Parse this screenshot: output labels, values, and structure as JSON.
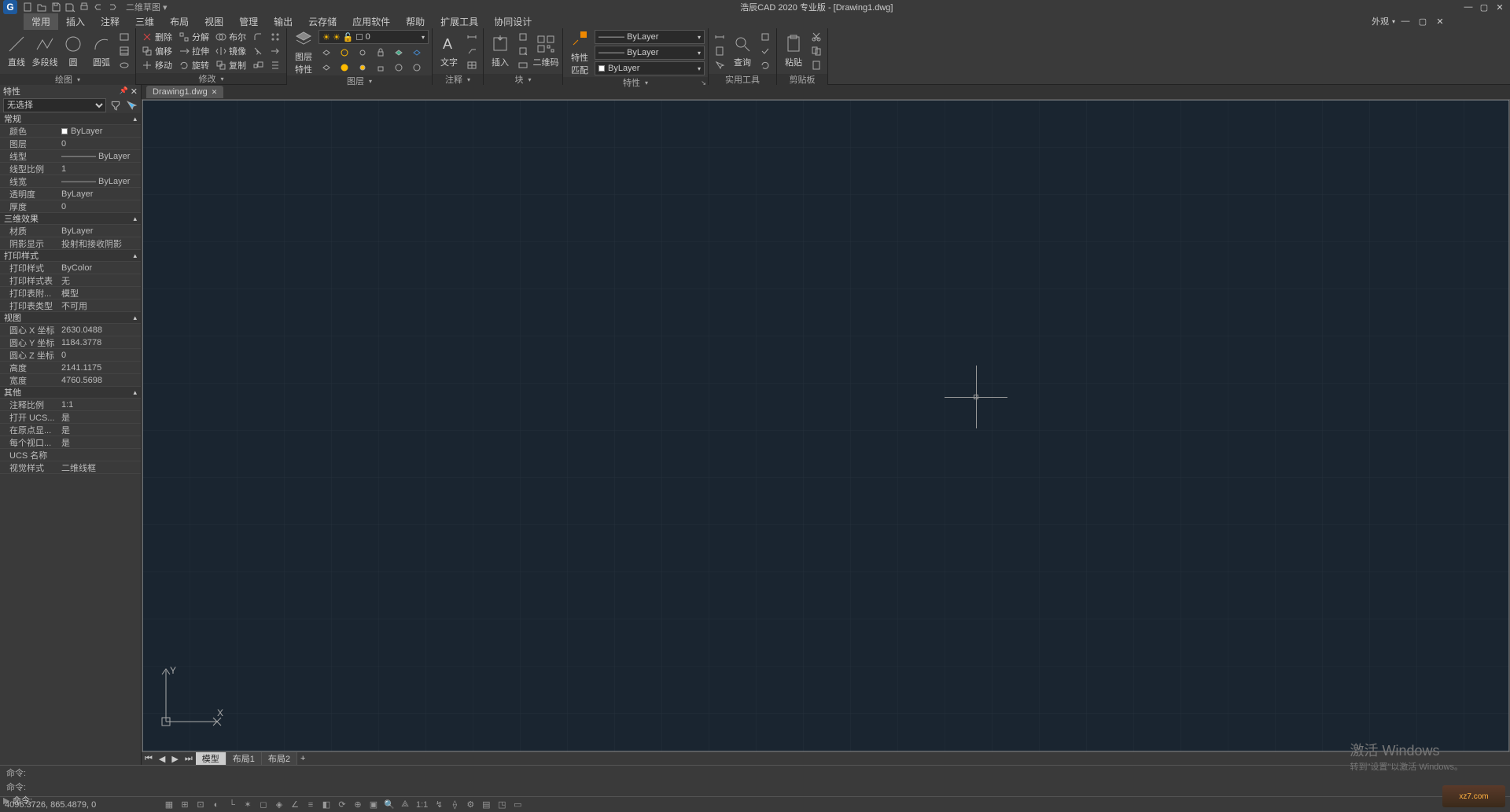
{
  "title": "浩辰CAD 2020 专业版 - [Drawing1.dwg]",
  "qat_dropdown": "二维草图",
  "menubar": {
    "items": [
      "常用",
      "插入",
      "注释",
      "三维",
      "布局",
      "视图",
      "管理",
      "输出",
      "云存储",
      "应用软件",
      "帮助",
      "扩展工具",
      "协同设计"
    ],
    "active": 0,
    "right": "外观"
  },
  "ribbon": {
    "draw": {
      "label": "绘图",
      "line": "直线",
      "polyline": "多段线",
      "circle": "圆",
      "arc": "圆弧"
    },
    "modify": {
      "label": "修改",
      "delete": "删除",
      "decompose": "分解",
      "boolean": "布尔",
      "offset": "偏移",
      "stretch": "拉伸",
      "mirror": "镜像",
      "move": "移动",
      "rotate": "旋转",
      "copy": "复制"
    },
    "layer": {
      "label": "图层",
      "props": "图层\n特性",
      "selected": "0"
    },
    "annotation": {
      "label": "注释",
      "text": "文字"
    },
    "block": {
      "label": "块",
      "insert": "插入",
      "qrcode": "二维码"
    },
    "properties": {
      "label": "特性",
      "match": "特性\n匹配",
      "layer1": "ByLayer",
      "layer2": "ByLayer",
      "layer3": "ByLayer"
    },
    "utils": {
      "label": "实用工具",
      "query": "查询"
    },
    "clipboard": {
      "label": "剪贴板",
      "paste": "粘贴"
    }
  },
  "props": {
    "title": "特性",
    "selection": "无选择",
    "groups": [
      {
        "name": "常规",
        "rows": [
          {
            "k": "颜色",
            "v": "ByLayer",
            "sq": true
          },
          {
            "k": "图层",
            "v": "0"
          },
          {
            "k": "线型",
            "v": "———— ByLayer"
          },
          {
            "k": "线型比例",
            "v": "1"
          },
          {
            "k": "线宽",
            "v": "———— ByLayer"
          },
          {
            "k": "透明度",
            "v": "ByLayer"
          },
          {
            "k": "厚度",
            "v": "0"
          }
        ]
      },
      {
        "name": "三维效果",
        "rows": [
          {
            "k": "材质",
            "v": "ByLayer"
          },
          {
            "k": "阴影显示",
            "v": "投射和接收阴影"
          }
        ]
      },
      {
        "name": "打印样式",
        "rows": [
          {
            "k": "打印样式",
            "v": "ByColor"
          },
          {
            "k": "打印样式表",
            "v": "无"
          },
          {
            "k": "打印表附...",
            "v": "模型"
          },
          {
            "k": "打印表类型",
            "v": "不可用"
          }
        ]
      },
      {
        "name": "视图",
        "rows": [
          {
            "k": "圆心 X 坐标",
            "v": "2630.0488"
          },
          {
            "k": "圆心 Y 坐标",
            "v": "1184.3778"
          },
          {
            "k": "圆心 Z 坐标",
            "v": "0"
          },
          {
            "k": "高度",
            "v": "2141.1175"
          },
          {
            "k": "宽度",
            "v": "4760.5698"
          }
        ]
      },
      {
        "name": "其他",
        "rows": [
          {
            "k": "注释比例",
            "v": "1:1"
          },
          {
            "k": "打开 UCS...",
            "v": "是"
          },
          {
            "k": "在原点显...",
            "v": "是"
          },
          {
            "k": "每个视口...",
            "v": "是"
          },
          {
            "k": "UCS 名称",
            "v": ""
          },
          {
            "k": "视觉样式",
            "v": "二维线框"
          }
        ]
      }
    ]
  },
  "doc_tab": "Drawing1.dwg",
  "layout_tabs": [
    "模型",
    "布局1",
    "布局2"
  ],
  "cmd": {
    "prompt": "命令:"
  },
  "status": {
    "coords": "4096.3726, 865.4879, 0",
    "annoscale": "1:1"
  },
  "watermark": {
    "line1": "激活 Windows",
    "line2": "转到\"设置\"以激活 Windows。"
  },
  "brand": "xz7.com"
}
